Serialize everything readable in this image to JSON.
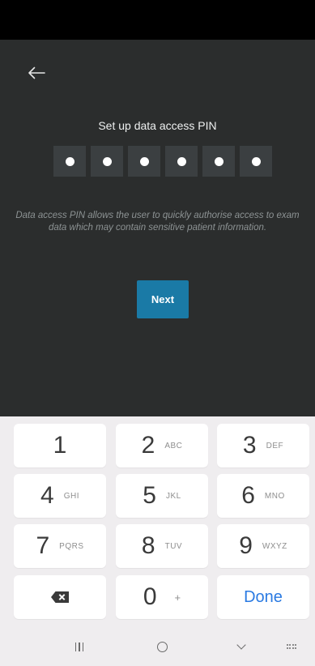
{
  "screen": {
    "title": "Set up data access PIN",
    "pin_length": 6,
    "pin_filled": 6,
    "description": "Data access PIN allows the user to quickly authorise access to exam data which may contain sensitive patient information.",
    "next_label": "Next"
  },
  "keypad": {
    "keys": [
      {
        "num": "1",
        "letters": ""
      },
      {
        "num": "2",
        "letters": "ABC"
      },
      {
        "num": "3",
        "letters": "DEF"
      },
      {
        "num": "4",
        "letters": "GHI"
      },
      {
        "num": "5",
        "letters": "JKL"
      },
      {
        "num": "6",
        "letters": "MNO"
      },
      {
        "num": "7",
        "letters": "PQRS"
      },
      {
        "num": "8",
        "letters": "TUV"
      },
      {
        "num": "9",
        "letters": "WXYZ"
      }
    ],
    "zero": {
      "num": "0",
      "extra": "+"
    },
    "done_label": "Done"
  },
  "colors": {
    "background": "#2b2d2d",
    "accent": "#1a7aa6",
    "done": "#2a7ae2"
  },
  "icons": {
    "back": "arrow-left-icon",
    "delete": "backspace-icon",
    "recents": "recents-icon",
    "home": "home-icon",
    "hide_keyboard": "chevron-down-icon",
    "keyboard": "keyboard-icon"
  }
}
